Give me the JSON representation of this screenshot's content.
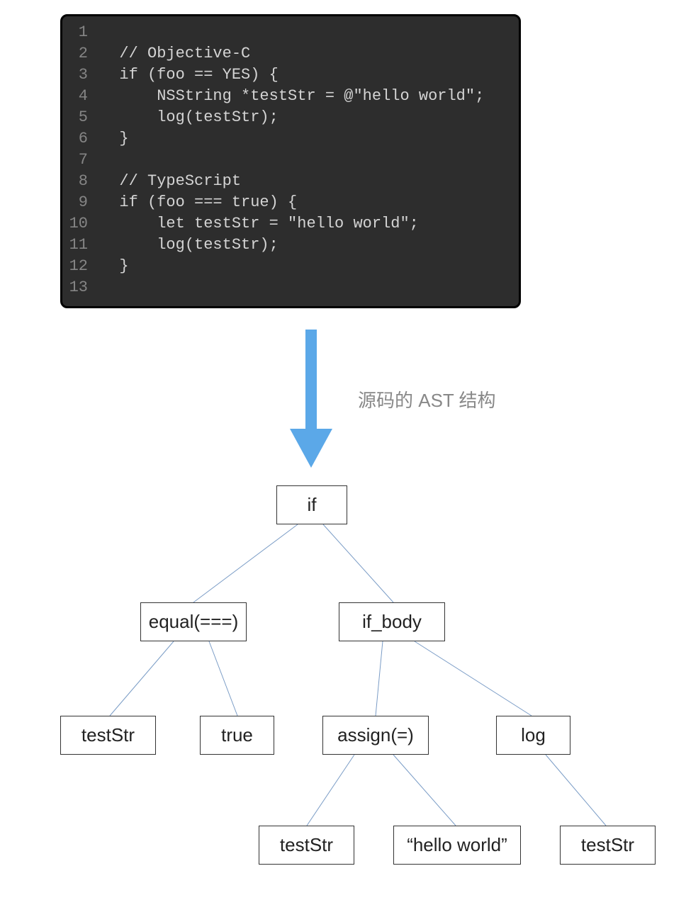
{
  "code": {
    "lines": [
      {
        "num": "1",
        "text": ""
      },
      {
        "num": "2",
        "text": "  // Objective-C"
      },
      {
        "num": "3",
        "text": "  if (foo == YES) {"
      },
      {
        "num": "4",
        "text": "      NSString *testStr = @\"hello world\";"
      },
      {
        "num": "5",
        "text": "      log(testStr);"
      },
      {
        "num": "6",
        "text": "  }"
      },
      {
        "num": "7",
        "text": ""
      },
      {
        "num": "8",
        "text": "  // TypeScript"
      },
      {
        "num": "9",
        "text": "  if (foo === true) {"
      },
      {
        "num": "10",
        "text": "      let testStr = \"hello world\";"
      },
      {
        "num": "11",
        "text": "      log(testStr);"
      },
      {
        "num": "12",
        "text": "  }"
      },
      {
        "num": "13",
        "text": ""
      }
    ]
  },
  "arrow": {
    "label": "源码的 AST 结构",
    "color": "#5BA8E8"
  },
  "tree": {
    "nodes": {
      "if": "if",
      "equal": "equal(===)",
      "if_body": "if_body",
      "testStr1": "testStr",
      "true": "true",
      "assign": "assign(=)",
      "log": "log",
      "testStr2": "testStr",
      "hello": "“hello world”",
      "testStr3": "testStr"
    }
  }
}
